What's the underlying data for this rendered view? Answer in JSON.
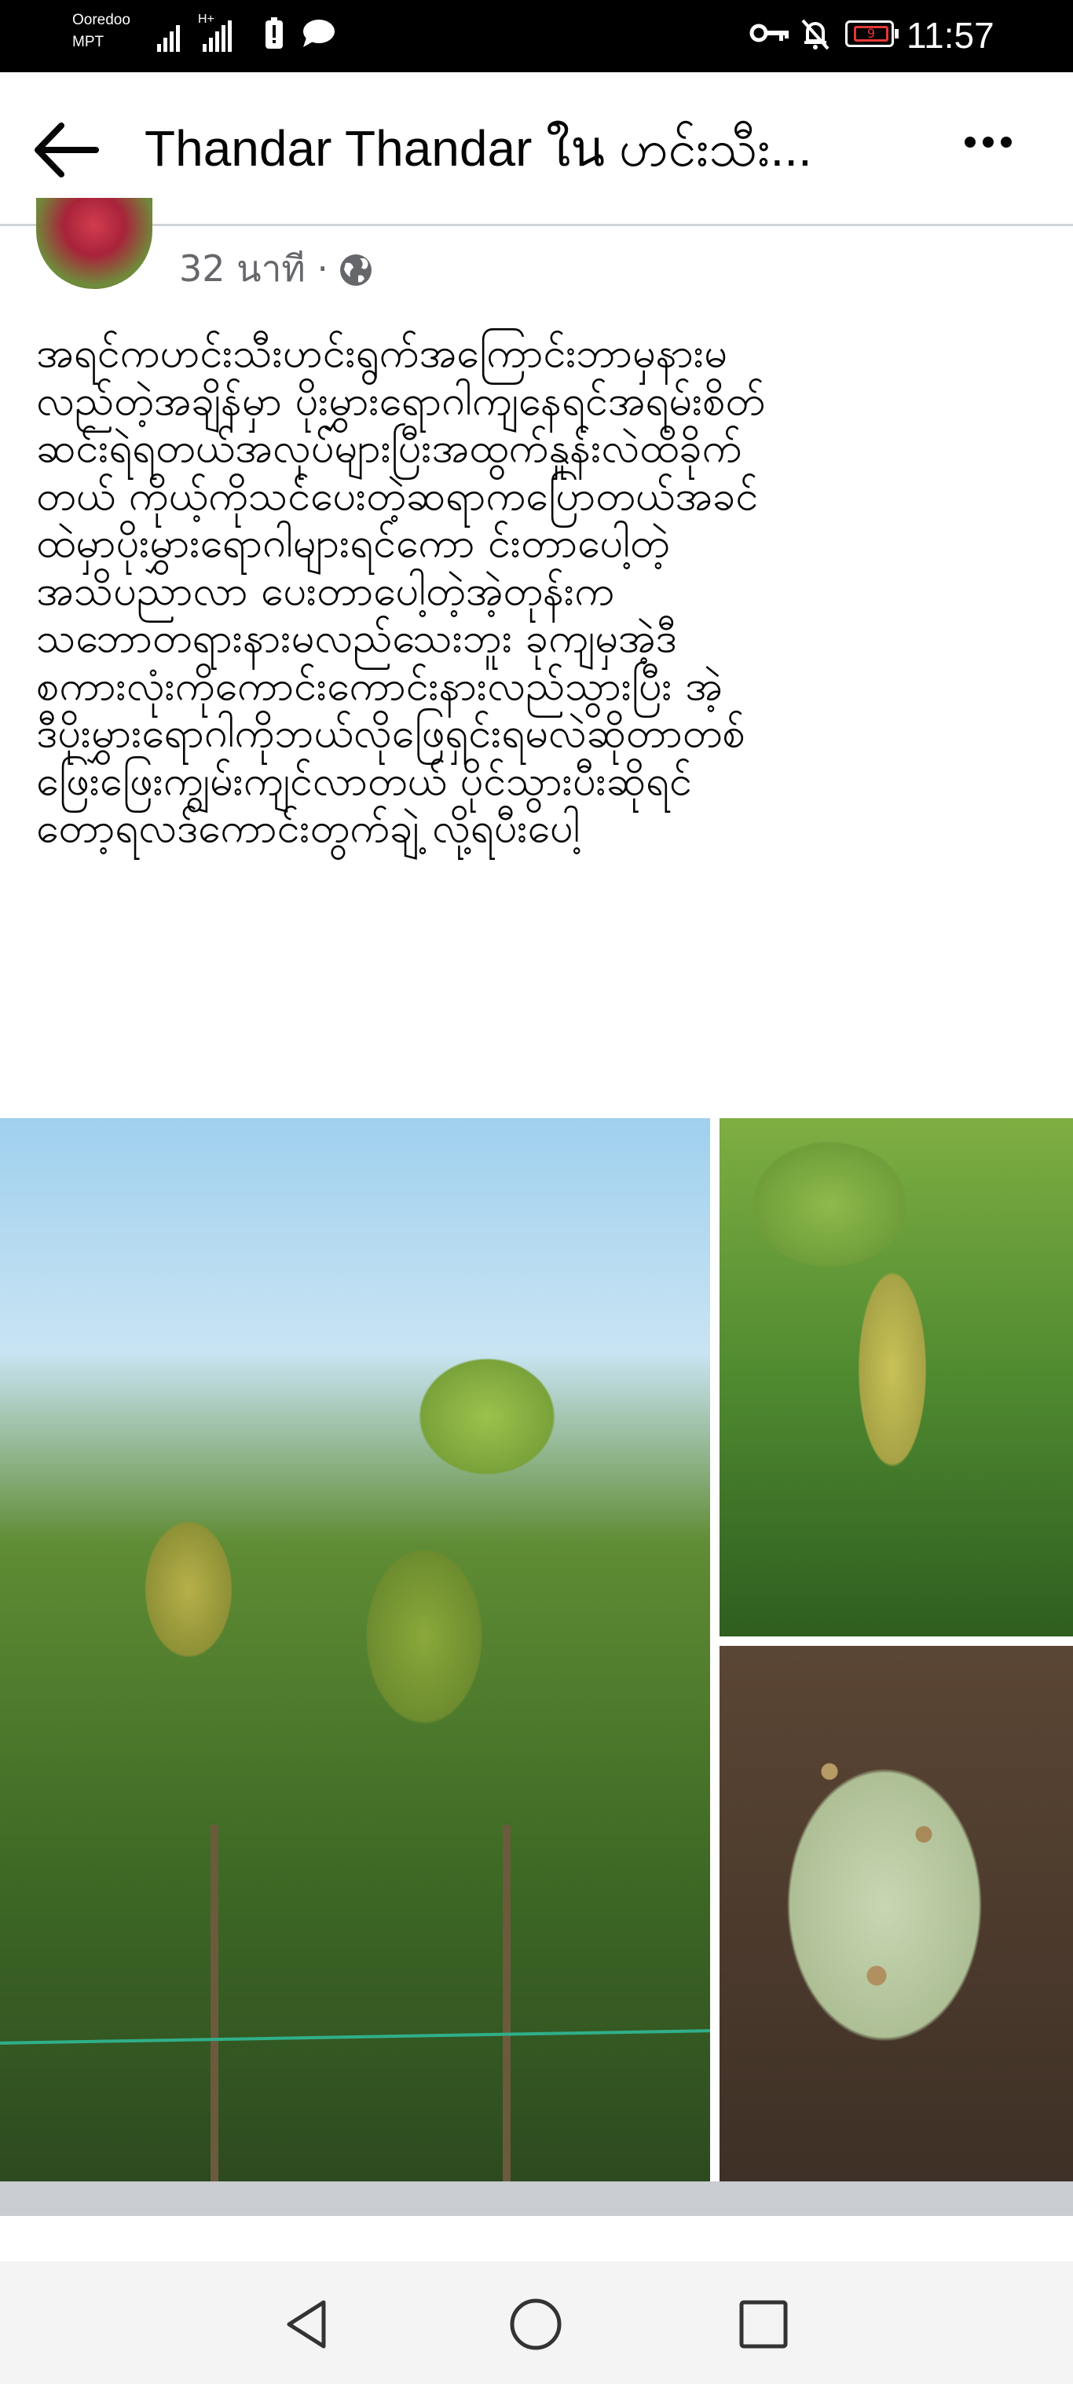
{
  "status_bar": {
    "carrier_line1": "Ooredoo",
    "carrier_line2": "MPT",
    "network_badge": "H+",
    "battery_level": "9",
    "time": "11:57",
    "icons": [
      "signal-icon",
      "battery-saver-icon",
      "message-icon",
      "key-icon",
      "mute-icon",
      "battery-icon"
    ]
  },
  "header": {
    "title": "Thandar Thandar ใน ဟင်းသီး...",
    "back_icon": "back-arrow-icon",
    "more_icon": "more-options-icon"
  },
  "post": {
    "timestamp": "32 นาที ·",
    "privacy_icon": "globe-icon",
    "lines": [
      "အရင်ကဟင်းသီးဟင်းရွက်အကြောင်းဘာမှနားမ",
      "လည်တဲ့အချိန်မှာ ပိုးမွှားရောဂါကျနေရင်အရမ်းစိတ်",
      "ဆင်းရဲရတယ်အလုပ်များပြီးအထွက်နှုန်းလဲထိခိုက်",
      "တယ် ကိုယ့်ကိုသင်ပေးတဲ့ဆရာကပြောတယ်အခင်",
      "ထဲမှာပိုးမွှားရောဂါများရင်ကော င်းတာပေါ့တဲ့",
      "အသိပညာလာ ပေးတာပေါ့တဲ့အဲ့တုန်းက",
      "သဘောတရားနားမလည်သေးဘူး ခုကျမှအဲ့ဒီ",
      "စကားလုံးကိုကောင်းကောင်းနားလည်သွားပြီး အဲ့",
      "ဒီပိုးမွှားရောဂါကိုဘယ်လိုဖြေရှင်းရမလဲဆိုတာတစ်",
      "ဖြေးဖြေးကျွမ်းကျင်လာတယ် ပိုင်သွားပီးဆိုရင်",
      "တော့ရလဒ်ကောင်းတွက်ချဲ့ လို့ရပီးပေါ့"
    ]
  },
  "navigation_bar": {
    "back_icon": "nav-back-icon",
    "home_icon": "nav-home-icon",
    "recents_icon": "nav-recents-icon"
  },
  "colors": {
    "text": "#050505",
    "secondary_text": "#65676b",
    "separator": "#c9ccd1",
    "battery_warning": "#e53935"
  }
}
